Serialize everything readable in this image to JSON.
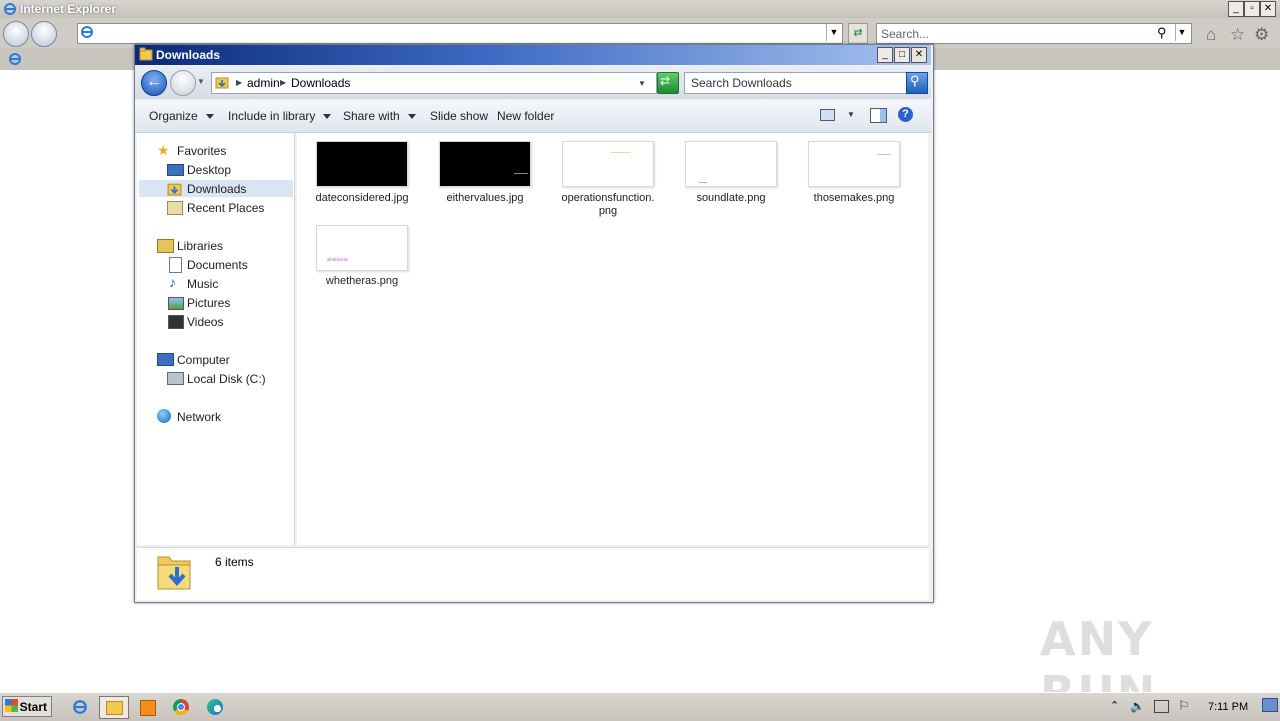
{
  "ie": {
    "title": "Internet Explorer",
    "search_placeholder": "Search..."
  },
  "explorer": {
    "title": "Downloads",
    "breadcrumb": [
      "admin",
      "Downloads"
    ],
    "search_placeholder": "Search Downloads",
    "commands": [
      "Organize",
      "Include in library",
      "Share with",
      "Slide show",
      "New folder"
    ],
    "nav": {
      "favorites": {
        "label": "Favorites",
        "items": [
          "Desktop",
          "Downloads",
          "Recent Places"
        ]
      },
      "libraries": {
        "label": "Libraries",
        "items": [
          "Documents",
          "Music",
          "Pictures",
          "Videos"
        ]
      },
      "computer": {
        "label": "Computer",
        "items": [
          "Local Disk (C:)"
        ]
      },
      "network": {
        "label": "Network"
      }
    },
    "selected_nav": "Downloads",
    "files": [
      {
        "name": "dateconsidered.jpg",
        "thumb": "#000000"
      },
      {
        "name": "eithervalues.jpg",
        "thumb": "#000000"
      },
      {
        "name_line1": "operationsfunction.",
        "name_line2": "png",
        "thumb": "#ffffff"
      },
      {
        "name": "soundlate.png",
        "thumb": "#ffffff"
      },
      {
        "name": "thosemakes.png",
        "thumb": "#ffffff"
      },
      {
        "name": "whetheras.png",
        "thumb": "#ffffff",
        "thumb_text": "whetheras"
      }
    ],
    "status": "6 items"
  },
  "taskbar": {
    "start": "Start",
    "clock": "7:11 PM"
  },
  "watermark": "ANY RUN",
  "colors": {
    "title_gradient_start": "#0a2a78",
    "selected_nav_bg": "#d9e5f3"
  }
}
